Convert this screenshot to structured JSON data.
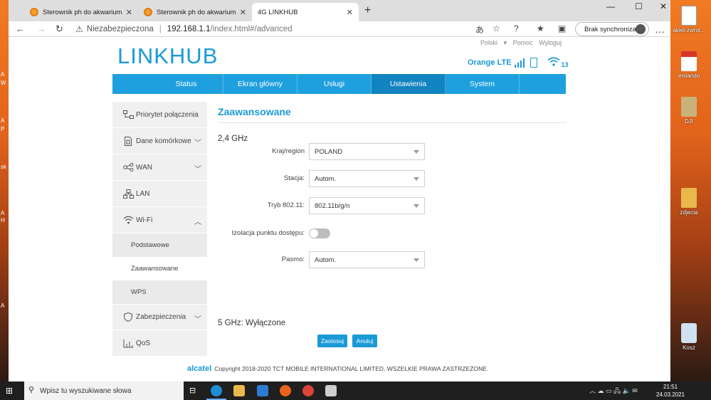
{
  "desktop": {
    "icons": [
      {
        "label": "akiet-zwrot...",
        "color": "#ffffff"
      },
      {
        "label": "enilando",
        "color": "#d9362b"
      },
      {
        "label": "DJI",
        "color": "#c8b27a"
      },
      {
        "label": "zdjecia",
        "color": "#e8b84a"
      },
      {
        "label": "Kosz",
        "color": "#cfe2ef"
      }
    ],
    "left_fragments": [
      "A",
      "W",
      "A",
      "P",
      "sk",
      "A",
      "H",
      "A"
    ]
  },
  "browser": {
    "tabs": [
      {
        "title": "Sterownik ph do akwarium – Stro",
        "icon": "orange-circle-icon",
        "active": false
      },
      {
        "title": "Sterownik ph do akwarium – Stro",
        "icon": "orange-circle-icon",
        "active": false
      },
      {
        "title": "4G LINKHUB",
        "icon": "page-icon",
        "active": true
      }
    ],
    "new_tab": "+",
    "window_controls": {
      "minimize": "—",
      "maximize": "☐",
      "close": "✕"
    },
    "address": {
      "security_label": "Niezabezpieczona",
      "host": "192.168.1.1",
      "path": "/index.html#/advanced"
    },
    "sync_label": "Brak synchronizacji",
    "menu": "…"
  },
  "page": {
    "logo_link": "LINK",
    "logo_hub": "HUB",
    "top_links": [
      "Polski",
      "Pomoc",
      "Wyloguj"
    ],
    "status": {
      "operator": "Orange",
      "network": "LTE",
      "wifi_clients": "13",
      "signal_bars": 4
    },
    "nav": [
      {
        "label": "Status",
        "active": false
      },
      {
        "label": "Ekran główny",
        "active": false
      },
      {
        "label": "Usługi",
        "active": false
      },
      {
        "label": "Ustawienia",
        "active": true
      },
      {
        "label": "System",
        "active": false
      }
    ],
    "sidebar": {
      "priority": "Priorytet połączenia",
      "mobile": "Dane komórkowe",
      "wan": "WAN",
      "lan": "LAN",
      "wifi": "Wi-Fi",
      "wifi_sub": [
        "Podstawowe",
        "Zaawansowane",
        "WPS"
      ],
      "security": "Zabezpieczenia",
      "qos": "QoS"
    },
    "content": {
      "title": "Zaawansowane",
      "section_24": "2,4 GHz",
      "fields": {
        "country_label": "Kraj/region",
        "country_value": "POLAND",
        "channel_label": "Stacja:",
        "channel_value": "Autom.",
        "mode_label": "Tryb 802.11:",
        "mode_value": "802.11b/g/n",
        "isolation_label": "Izolacja punktu dostępu:",
        "isolation_on": false,
        "bandwidth_label": "Pasmo:",
        "bandwidth_value": "Autom."
      },
      "section_5": "5 GHz: Wyłączone",
      "apply": "Zastosuj",
      "cancel": "Anuluj"
    },
    "footer": {
      "brand": "alcatel",
      "copyright": "Copyright 2018-2020 TCT MOBILE INTERNATIONAL LIMITED. WSZELKIE PRAWA ZASTRZEŻONE."
    }
  },
  "taskbar": {
    "search_placeholder": "Wpisz tu wyszukiwane słowa",
    "time": "21:51",
    "date": "24.03.2021"
  },
  "colors": {
    "accent": "#1a9ad6",
    "nav_active": "#1183c0"
  }
}
